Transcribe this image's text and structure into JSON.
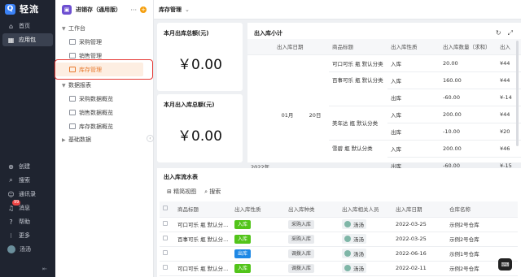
{
  "app": {
    "logo_text": "轻流",
    "logo_glyph": "Q"
  },
  "rail": {
    "top_items": [
      {
        "label": "首页",
        "icon": "home-icon"
      },
      {
        "label": "应用包",
        "icon": "grid-icon"
      }
    ],
    "bottom_items": [
      {
        "label": "创建",
        "icon": "plus-icon"
      },
      {
        "label": "搜索",
        "icon": "search-icon"
      },
      {
        "label": "通讯录",
        "icon": "contacts-icon"
      },
      {
        "label": "消息",
        "icon": "bell-icon",
        "badge": "99"
      },
      {
        "label": "帮助",
        "icon": "help-icon"
      },
      {
        "label": "更多",
        "icon": "more-icon"
      },
      {
        "label": "汤汤",
        "icon": "avatar"
      }
    ],
    "collapse": "⇤"
  },
  "nav": {
    "title": "进销存（通用版）",
    "more": "···",
    "plus": "+",
    "groups": [
      {
        "label": "工作台",
        "items": [
          "采购管理",
          "销售管理",
          "库存管理"
        ],
        "active": 2
      },
      {
        "label": "数据报表",
        "items": [
          "采购数据概览",
          "销售数据概览",
          "库存数据概览"
        ]
      },
      {
        "label": "基础数据",
        "items": []
      }
    ]
  },
  "main": {
    "page_title": "库存管理",
    "card_out": {
      "title": "本月出库总额(元)",
      "value": "￥0.00"
    },
    "card_in": {
      "title": "本月出入库总额(元)",
      "value": "￥0.00"
    },
    "pivot": {
      "title": "出入库小计",
      "headers": [
        "出入库日期",
        "",
        "商品标题",
        "出入库性质",
        "出入库数量（求和）",
        "出入"
      ],
      "year": "2022年",
      "month": "01月",
      "day": "20日",
      "rows": [
        {
          "product": "可口可乐 瓶 默认分类",
          "kind": "入库",
          "qty": "20.00",
          "amt": "¥44"
        },
        {
          "product": "百事可乐 瓶 默认分类",
          "kind": "入库",
          "qty": "160.00",
          "amt": "¥44"
        },
        {
          "product": "",
          "kind": "出库",
          "qty": "-60.00",
          "amt": "¥-14"
        },
        {
          "product": "美年达 瓶 默认分类",
          "kind": "入库",
          "qty": "200.00",
          "amt": "¥44"
        },
        {
          "product": "",
          "kind": "出库",
          "qty": "-10.00",
          "amt": "¥20"
        },
        {
          "product": "雪碧 瓶 默认分类",
          "kind": "入库",
          "qty": "200.00",
          "amt": "¥46"
        },
        {
          "product": "",
          "kind": "出库",
          "qty": "-60.00",
          "amt": "¥-15"
        }
      ]
    },
    "flow": {
      "title": "出入库流水表",
      "view_label": "精简视图",
      "search_label": "搜索",
      "headers": [
        "商品标题",
        "出入库性质",
        "出入库种类",
        "出入库相关人员",
        "出入库日期",
        "仓库名称"
      ],
      "rows": [
        {
          "product": "可口可乐 瓶 默认分...",
          "kind": "入库",
          "kind_color": "green",
          "type": "采购入库",
          "person": "汤汤",
          "date": "2022-03-25",
          "wh": "示例2号仓库"
        },
        {
          "product": "百事可乐 瓶 默认分...",
          "kind": "入库",
          "kind_color": "green",
          "type": "采购入库",
          "person": "汤汤",
          "date": "2022-03-25",
          "wh": "示例2号仓库"
        },
        {
          "product": "",
          "kind": "出库",
          "kind_color": "blue",
          "type": "调拨入库",
          "person": "汤汤",
          "date": "2022-06-16",
          "wh": "示例1号仓库"
        },
        {
          "product": "可口可乐 瓶 默认分...",
          "kind": "入库",
          "kind_color": "green",
          "type": "调拨入库",
          "person": "汤汤",
          "date": "2022-02-11",
          "wh": "示例2号仓库"
        }
      ]
    }
  }
}
